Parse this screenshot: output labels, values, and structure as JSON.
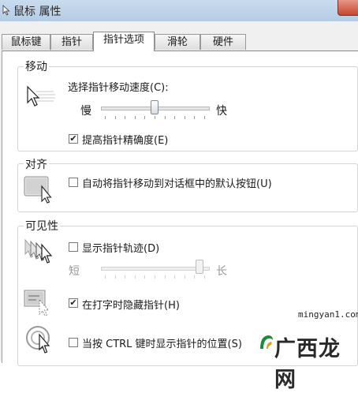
{
  "window": {
    "title": "鼠标 属性"
  },
  "tabs": [
    "鼠标键",
    "指针",
    "指针选项",
    "滑轮",
    "硬件"
  ],
  "active_tab_index": 2,
  "motion": {
    "title": "移动",
    "speed_label": "选择指针移动速度(C):",
    "slow_label": "慢",
    "fast_label": "快",
    "speed_level": 0.5,
    "precision_label": "提高指针精确度(E)",
    "precision_checked": true
  },
  "snap_to": {
    "title": "对齐",
    "label": "自动将指针移动到对话框中的默认按钮(U)",
    "checked": false
  },
  "visibility": {
    "title": "可见性",
    "trails_label": "显示指针轨迹(D)",
    "trails_checked": false,
    "short_label": "短",
    "long_label": "长",
    "trails_level": 0.95,
    "hide_label": "在打字时隐藏指针(H)",
    "hide_checked": true,
    "ctrl_label": "当按 CTRL 键时显示指针的位置(S)",
    "ctrl_checked": false
  },
  "watermark": {
    "url": "mingyan1.com",
    "text": "广西龙网"
  },
  "icons": {
    "title": "mouse-cursor-icon",
    "motion": "pointer-speed-icon",
    "snap": "snap-to-button-icon",
    "trails": "pointer-trails-icon",
    "hide": "hide-while-typing-icon",
    "ctrl": "ctrl-locate-pointer-icon"
  }
}
